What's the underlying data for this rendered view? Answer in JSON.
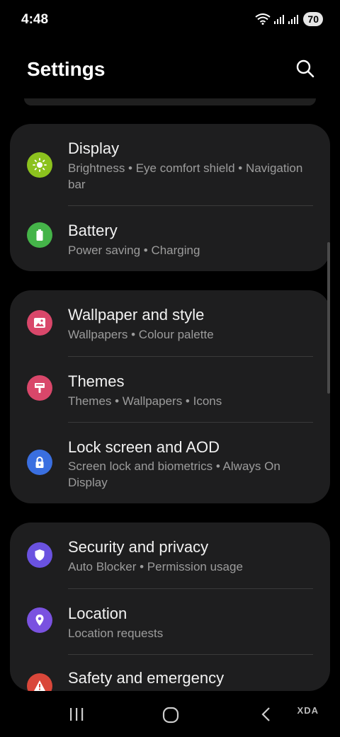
{
  "status_bar": {
    "time": "4:48",
    "battery": "70",
    "icons": [
      "wifi-icon",
      "signal-icon",
      "signal-icon"
    ]
  },
  "header": {
    "title": "Settings",
    "search_icon": "search-icon"
  },
  "cards": [
    {
      "items": [
        {
          "title": "Display",
          "subtitle": "Brightness  •  Eye comfort shield  •  Navigation bar",
          "icon": "sun-icon",
          "color": "#8cc21e"
        },
        {
          "title": "Battery",
          "subtitle": "Power saving  •  Charging",
          "icon": "battery-icon",
          "color": "#45b449"
        }
      ]
    },
    {
      "items": [
        {
          "title": "Wallpaper and style",
          "subtitle": "Wallpapers  •  Colour palette",
          "icon": "image-icon",
          "color": "#d9476a"
        },
        {
          "title": "Themes",
          "subtitle": "Themes  •  Wallpapers  •  Icons",
          "icon": "brush-icon",
          "color": "#d9476a"
        },
        {
          "title": "Lock screen and AOD",
          "subtitle": "Screen lock and biometrics  •  Always On Display",
          "icon": "lock-icon",
          "color": "#3a6fe0"
        }
      ]
    },
    {
      "items": [
        {
          "title": "Security and privacy",
          "subtitle": "Auto Blocker  •  Permission usage",
          "icon": "shield-icon",
          "color": "#6a52e0"
        },
        {
          "title": "Location",
          "subtitle": "Location requests",
          "icon": "location-pin-icon",
          "color": "#7a52e0"
        },
        {
          "title": "Safety and emergency",
          "subtitle": "",
          "icon": "alert-icon",
          "color": "#d9473a"
        }
      ]
    }
  ],
  "nav_bar": {
    "recents_icon": "recents-icon",
    "home_icon": "home-icon",
    "back_icon": "back-icon"
  },
  "watermark": "XDA"
}
